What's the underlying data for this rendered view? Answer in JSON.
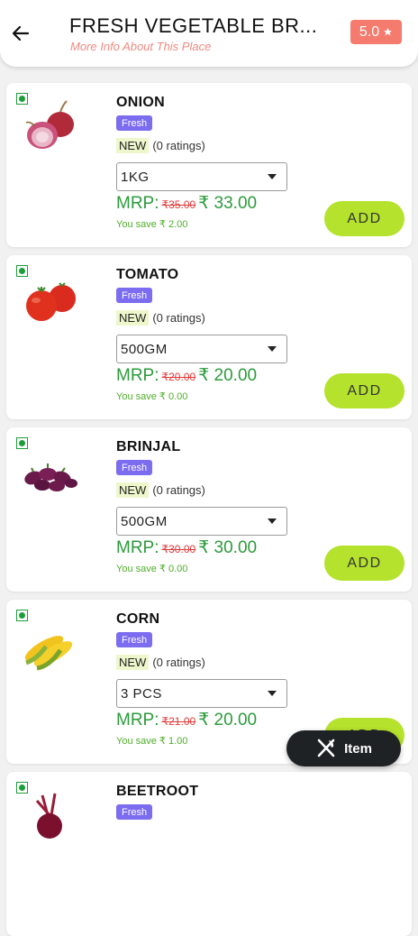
{
  "header": {
    "title": "FRESH VEGETABLE BR...",
    "subtitle": "More Info About This Place",
    "rating": "5.0",
    "back_icon": "arrow-left-icon",
    "star_icon": "star-icon"
  },
  "products": [
    {
      "name": "ONION",
      "badge": "Fresh",
      "new_tag": "NEW",
      "ratings": "(0 ratings)",
      "unit": "1KG",
      "mrp_label": "MRP:",
      "old_price": "₹35.00",
      "price": "₹ 33.00",
      "save_text": "You save ₹ 2.00",
      "add_label": "ADD"
    },
    {
      "name": "TOMATO",
      "badge": "Fresh",
      "new_tag": "NEW",
      "ratings": "(0 ratings)",
      "unit": "500GM",
      "mrp_label": "MRP:",
      "old_price": "₹20.00",
      "price": "₹ 20.00",
      "save_text": "You save ₹ 0.00",
      "add_label": "ADD"
    },
    {
      "name": "BRINJAL",
      "badge": "Fresh",
      "new_tag": "NEW",
      "ratings": "(0 ratings)",
      "unit": "500GM",
      "mrp_label": "MRP:",
      "old_price": "₹30.00",
      "price": "₹ 30.00",
      "save_text": "You save ₹ 0.00",
      "add_label": "ADD"
    },
    {
      "name": "CORN",
      "badge": "Fresh",
      "new_tag": "NEW",
      "ratings": "(0 ratings)",
      "unit": "3 PCS",
      "mrp_label": "MRP:",
      "old_price": "₹21.00",
      "price": "₹ 20.00",
      "save_text": "You save ₹ 1.00",
      "add_label": "ADD"
    },
    {
      "name": "BEETROOT",
      "badge": "Fresh"
    }
  ],
  "fab": {
    "label": "Item",
    "icon": "fork-knife-icon"
  },
  "colors": {
    "accent_green": "#b5e22c",
    "price_green": "#2b9b3b",
    "badge_purple": "#7b6cf0",
    "rating_bg": "#f47b6e",
    "strike_red": "#e23a3a",
    "fab_bg": "#1f2224"
  }
}
